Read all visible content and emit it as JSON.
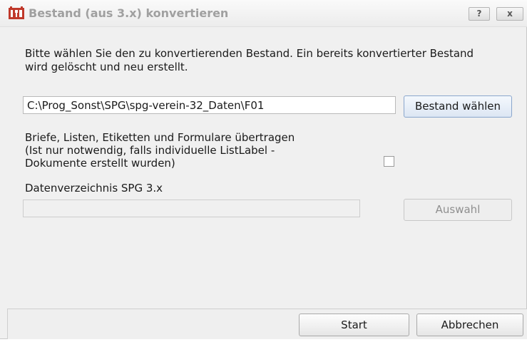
{
  "window": {
    "title": "Bestand (aus 3.x) konvertieren",
    "help_label": "?",
    "close_label": "x"
  },
  "main": {
    "intro_line1": "Bitte wählen Sie den zu konvertierenden Bestand. Ein bereits konvertierter Bestand",
    "intro_line2": "wird gelöscht und neu erstellt.",
    "path_value": "C:\\Prog_Sonst\\SPG\\spg-verein-32_Daten\\F01",
    "choose_button": "Bestand wählen",
    "option_line1": "Briefe, Listen, Etiketten und Formulare übertragen",
    "option_line2": "(Ist nur notwendig, falls individuelle ListLabel -",
    "option_line3": "Dokumente erstellt wurden)",
    "option_checked": false,
    "dir_label": "Datenverzeichnis SPG 3.x",
    "dir_value": "",
    "select_button": "Auswahl"
  },
  "footer": {
    "start_button": "Start",
    "cancel_button": "Abbrechen"
  },
  "colors": {
    "accent_icon": "#c0392b",
    "title_text": "#a0a0a0"
  },
  "icons": {
    "app": "app-logo-icon"
  }
}
